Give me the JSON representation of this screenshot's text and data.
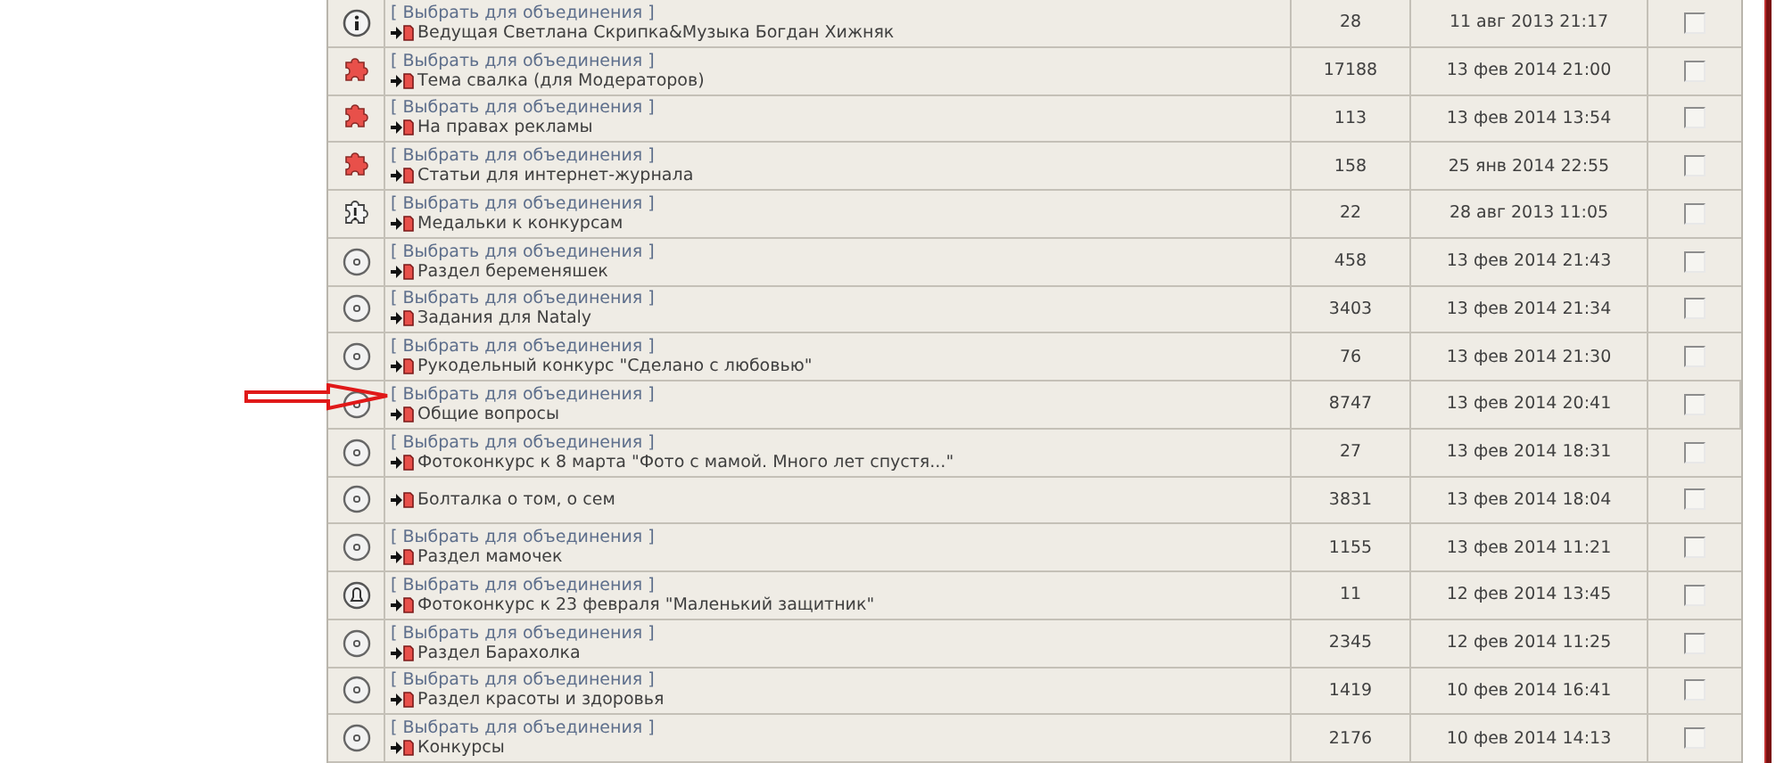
{
  "rows": [
    {
      "kind": "info",
      "link": "[ Выбрать для объединения ]",
      "title": "Ведущая Светлана Скрипка&Музыка Богдан Хижняк",
      "count": "28",
      "date": "11 авг 2013 21:17",
      "checked": false,
      "arrow": false
    },
    {
      "kind": "puzzle",
      "link": "[ Выбрать для объединения ]",
      "title": "Тема свалка (для Модераторов)",
      "count": "17188",
      "date": "13 фев 2014 21:00",
      "checked": false,
      "arrow": false
    },
    {
      "kind": "puzzle",
      "link": "[ Выбрать для объединения ]",
      "title": "На правах рекламы",
      "count": "113",
      "date": "13 фев 2014 13:54",
      "checked": false,
      "arrow": false
    },
    {
      "kind": "puzzle",
      "link": "[ Выбрать для объединения ]",
      "title": "Статьи для интернет-журнала",
      "count": "158",
      "date": "25 янв 2014 22:55",
      "checked": false,
      "arrow": false
    },
    {
      "kind": "alert",
      "link": "[ Выбрать для объединения ]",
      "title": "Медальки к конкурсам",
      "count": "22",
      "date": "28 авг 2013 11:05",
      "checked": false,
      "arrow": false
    },
    {
      "kind": "plain",
      "link": "[ Выбрать для объединения ]",
      "title": "Раздел беременяшек",
      "count": "458",
      "date": "13 фев 2014 21:43",
      "checked": false,
      "arrow": false
    },
    {
      "kind": "plain",
      "link": "[ Выбрать для объединения ]",
      "title": "Задания для Nataly",
      "count": "3403",
      "date": "13 фев 2014 21:34",
      "checked": false,
      "arrow": false
    },
    {
      "kind": "plain",
      "link": "[ Выбрать для объединения ]",
      "title": "Рукодельный конкурс \"Сделано с любовью\"",
      "count": "76",
      "date": "13 фев 2014 21:30",
      "checked": false,
      "arrow": false
    },
    {
      "kind": "plain",
      "link": "[ Выбрать для объединения ]",
      "title": "Общие вопросы",
      "count": "8747",
      "date": "13 фев 2014 20:41",
      "checked": false,
      "arrow": true
    },
    {
      "kind": "plain",
      "link": "[ Выбрать для объединения ]",
      "title": "Фотоконкурс к 8 марта \"Фото с мамой. Много лет спустя...\"",
      "count": "27",
      "date": "13 фев 2014 18:31",
      "checked": false,
      "arrow": false
    },
    {
      "kind": "plain",
      "title": "Болталка о том, о сем",
      "count": "3831",
      "date": "13 фев 2014 18:04",
      "checked": false,
      "arrow": false
    },
    {
      "kind": "plain",
      "link": "[ Выбрать для объединения ]",
      "title": "Раздел мамочек",
      "count": "1155",
      "date": "13 фев 2014 11:21",
      "checked": false,
      "arrow": false
    },
    {
      "kind": "bell",
      "link": "[ Выбрать для объединения ]",
      "title": "Фотоконкурс к 23 февраля \"Маленький защитник\"",
      "count": "11",
      "date": "12 фев 2014 13:45",
      "checked": false,
      "arrow": false
    },
    {
      "kind": "plain",
      "link": "[ Выбрать для объединения ]",
      "title": "Раздел Барахолка",
      "count": "2345",
      "date": "12 фев 2014 11:25",
      "checked": false,
      "arrow": false
    },
    {
      "kind": "plain",
      "link": "[ Выбрать для объединения ]",
      "title": "Раздел красоты и здоровья",
      "count": "1419",
      "date": "10 фев 2014 16:41",
      "checked": false,
      "arrow": false
    },
    {
      "kind": "plain",
      "link": "[ Выбрать для объединения ]",
      "title": "Конкурсы",
      "count": "2176",
      "date": "10 фев 2014 14:13",
      "checked": false,
      "arrow": false
    }
  ]
}
